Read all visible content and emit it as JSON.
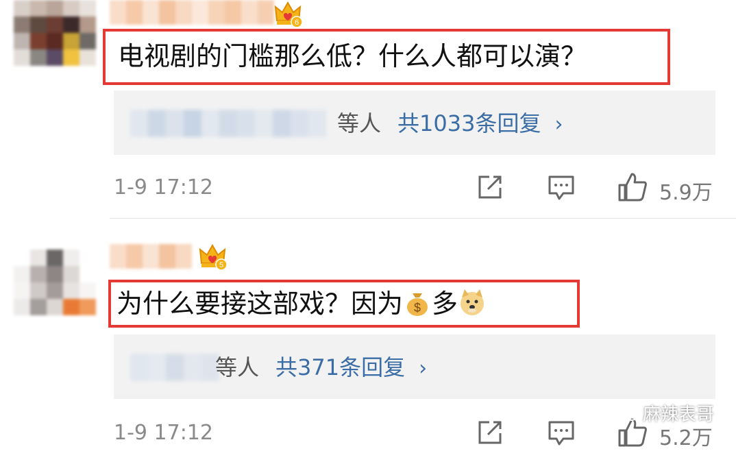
{
  "comments": [
    {
      "content": "电视剧的门槛那么低？什么人都可以演？",
      "reply_suffix": "等人",
      "reply_link": "共1033条回复",
      "timestamp": "1-9 17:12",
      "likes": "5.9万",
      "badge_level": "6"
    },
    {
      "content_part1": "为什么要接这部戏？因为",
      "content_part2": "多",
      "reply_suffix": "等人",
      "reply_link": "共371条回复",
      "timestamp": "1-9 17:12",
      "likes": "5.2万",
      "badge_level": "5"
    }
  ],
  "icons": {
    "chevron": "›",
    "repost": "repost-icon",
    "comment": "comment-icon",
    "like": "like-icon",
    "money_bag": "money-bag-emoji",
    "doge": "doge-emoji"
  },
  "watermark": {
    "text": "麻辣表哥"
  },
  "colors": {
    "highlight_border": "#e53935",
    "link": "#3a6da6",
    "panel": "#f2f2f2",
    "meta": "#8a8a8a"
  }
}
